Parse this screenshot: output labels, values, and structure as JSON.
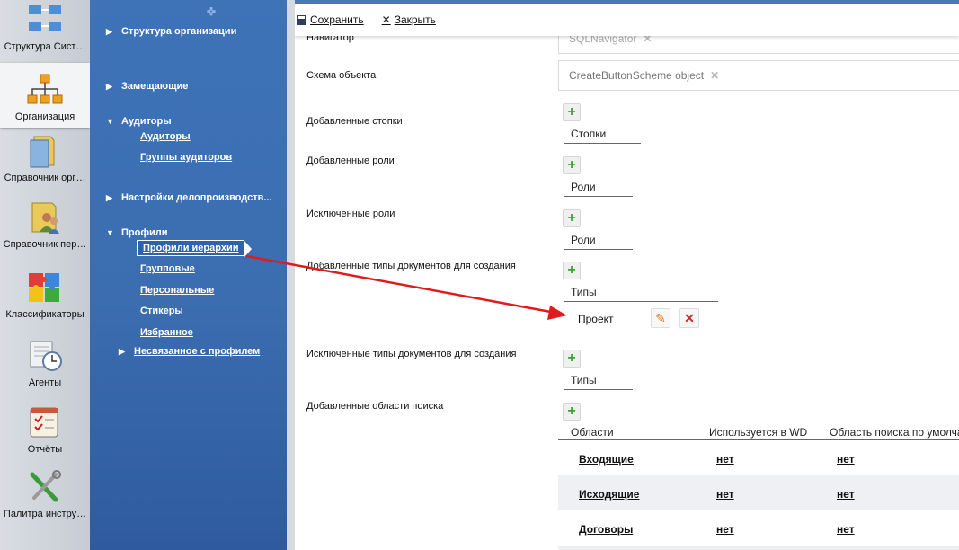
{
  "rail": {
    "items": [
      {
        "label": "Структура Сист…",
        "icon": "structure-icon"
      },
      {
        "label": "Организация",
        "icon": "org-chart-icon",
        "active": true
      },
      {
        "label": "Справочник орг…",
        "icon": "folder-icon"
      },
      {
        "label": "Справочник пер…",
        "icon": "people-folder-icon"
      },
      {
        "label": "Классификаторы",
        "icon": "puzzle-icon"
      },
      {
        "label": "Агенты",
        "icon": "clock-icon"
      },
      {
        "label": "Отчёты",
        "icon": "checklist-icon"
      },
      {
        "label": "Палитра инстру…",
        "icon": "tools-icon"
      }
    ]
  },
  "nav": {
    "sections": [
      {
        "label": "Структура организации"
      },
      {
        "label": "Замещающие"
      },
      {
        "label": "Аудиторы",
        "children": [
          "Аудиторы",
          "Группы аудиторов"
        ]
      },
      {
        "label": "Настройки делопроизводств..."
      },
      {
        "label": "Профили",
        "children": [
          "Профили иерархии",
          "Групповые",
          "Персональные",
          "Стикеры",
          "Избранное"
        ]
      },
      {
        "label": "Несвязанное с профилем"
      }
    ],
    "selected": "Профили иерархии"
  },
  "toolbar": {
    "save_label": "Сохранить",
    "close_label": "Закрыть"
  },
  "form": {
    "navigator": {
      "label": "Навигатор",
      "value": "SQLNavigator"
    },
    "scheme": {
      "label": "Схема объекта",
      "value": "CreateButtonScheme object"
    },
    "added_columns": {
      "label": "Добавленные стопки",
      "header": "Стопки"
    },
    "added_roles": {
      "label": "Добавленные роли",
      "header": "Роли"
    },
    "excluded_roles": {
      "label": "Исключенные роли",
      "header": "Роли"
    },
    "added_doc_types": {
      "label": "Добавленные типы документов для создания",
      "header": "Типы",
      "items": [
        "Проект"
      ]
    },
    "excluded_doc_types": {
      "label": "Исключенные типы документов для создания",
      "header": "Типы"
    },
    "search_areas": {
      "label": "Добавленные области поиска",
      "columns": [
        "Области",
        "Используется в WD",
        "Область поиска по умолча"
      ],
      "rows": [
        [
          "Входящие",
          "нет",
          "нет"
        ],
        [
          "Исходящие",
          "нет",
          "нет"
        ],
        [
          "Договоры",
          "нет",
          "нет"
        ]
      ]
    }
  },
  "colors": {
    "nav_bg": "#3b6db0",
    "accent_border": "#4a79b8",
    "arrow": "#e01b1b",
    "plus": "#3aa235"
  }
}
